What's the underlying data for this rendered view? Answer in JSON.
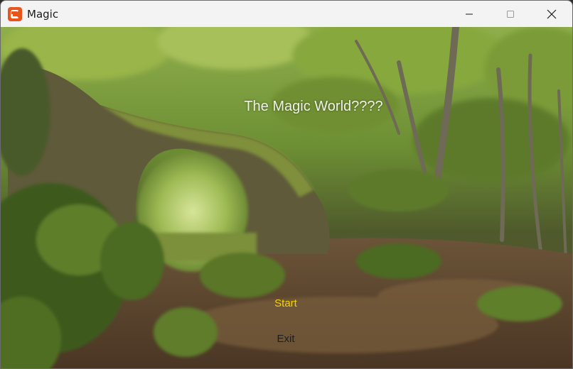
{
  "window": {
    "title": "Magic",
    "app_icon": "monogame-icon",
    "controls": [
      "minimize-icon",
      "maximize-icon",
      "close-icon"
    ]
  },
  "game": {
    "title_text": "The Magic World????",
    "menu": [
      {
        "label": "Start",
        "selected": true,
        "color": "#f2d200"
      },
      {
        "label": "Exit",
        "selected": false,
        "color": "#1e1e1e"
      }
    ],
    "background": "forest-stone-arch-scene"
  }
}
